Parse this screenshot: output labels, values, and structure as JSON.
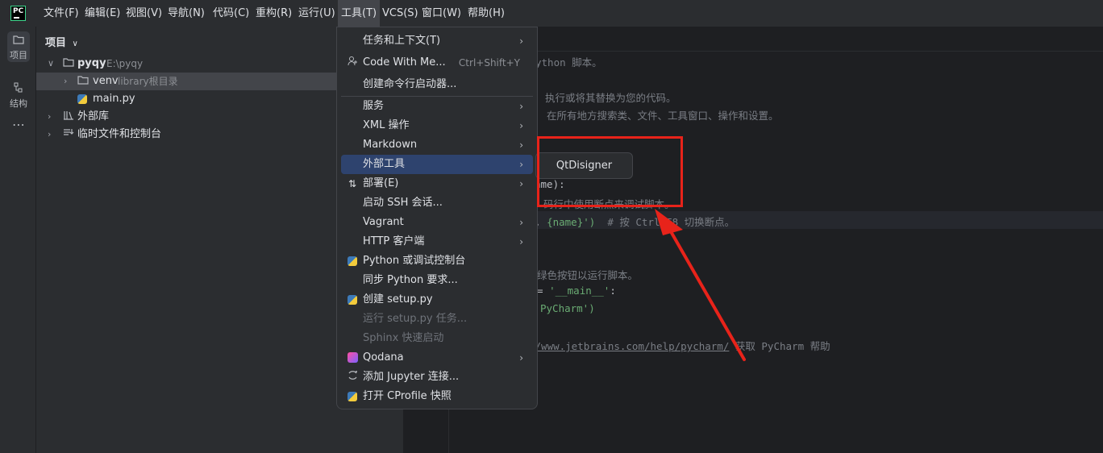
{
  "menubar": {
    "items": [
      "文件(F)",
      "编辑(E)",
      "视图(V)",
      "导航(N)",
      "代码(C)",
      "重构(R)",
      "运行(U)",
      "工具(T)",
      "VCS(S)",
      "窗口(W)",
      "帮助(H)"
    ],
    "active": "工具(T)"
  },
  "toolstrip": {
    "project_label": "项目",
    "structure_label": "结构",
    "more": "⋯"
  },
  "project_panel": {
    "title": "项目",
    "root_name": "pyqy",
    "root_path": "E:\\pyqy",
    "venv_name": "venv",
    "venv_hint": "library根目录",
    "main_file": "main.py",
    "external_libs": "外部库",
    "scratches": "临时文件和控制台"
  },
  "editor": {
    "lines": {
      "l1": "ython 脚本。",
      "l2": "执行或将其替换为您的代码。",
      "l3": "在所有地方搜索类、文件、工具窗口、操作和设置。",
      "l4a": "ame):",
      "l5": "码行中使用断点来调试脚本。",
      "l6a": ", ",
      "l6b": "{name}')",
      "l6c": "  # 按 Ctrl+F8 切换断点。",
      "l7": "绿色按钮以运行脚本。",
      "l8a": "= ",
      "l8b": "'__main__'",
      "l8c": ":",
      "l9": "PyCharm')",
      "l10a": "//www.jetbrains.com/help/pycharm/",
      "l10b": " 获取 PyCharm 帮助"
    }
  },
  "tools_menu": {
    "items": [
      {
        "label": "任务和上下文(T)",
        "submenu": true
      },
      {
        "label": "Code With Me...",
        "shortcut": "Ctrl+Shift+Y",
        "icon": "person-add-icon"
      },
      {
        "label": "创建命令行启动器..."
      },
      {
        "label": "服务",
        "submenu": true
      },
      {
        "label": "XML 操作",
        "submenu": true
      },
      {
        "label": "Markdown",
        "submenu": true
      },
      {
        "label": "外部工具",
        "submenu": true,
        "highlighted": true
      },
      {
        "label": "部署(E)",
        "submenu": true,
        "icon": "deploy-icon"
      },
      {
        "label": "启动 SSH 会话..."
      },
      {
        "label": "Vagrant",
        "submenu": true
      },
      {
        "label": "HTTP 客户端",
        "submenu": true
      },
      {
        "label": "Python 或调试控制台",
        "icon": "python-icon"
      },
      {
        "label": "同步 Python 要求..."
      },
      {
        "label": "创建 setup.py",
        "icon": "python-icon"
      },
      {
        "label": "运行 setup.py 任务...",
        "disabled": true
      },
      {
        "label": "Sphinx 快速启动",
        "disabled": true
      },
      {
        "label": "Qodana",
        "submenu": true,
        "icon": "qodana-icon"
      },
      {
        "label": "添加 Jupyter 连接...",
        "icon": "jupyter-icon"
      },
      {
        "label": "打开 CProfile 快照",
        "icon": "profile-icon"
      }
    ]
  },
  "submenu": {
    "item": "QtDisigner"
  },
  "colors": {
    "highlight": "#2e436e",
    "annotation": "#e8231a",
    "background": "#1e1f22",
    "panel": "#2b2d30"
  }
}
